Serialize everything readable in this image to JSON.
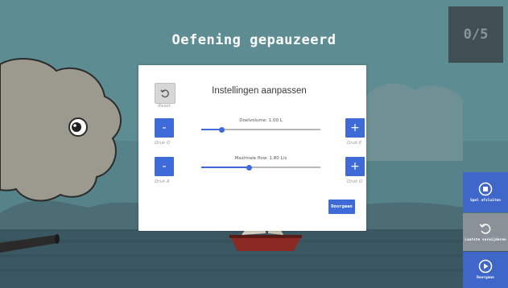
{
  "header": {
    "title": "Oefening gepauzeerd",
    "progress": "0/5"
  },
  "modal": {
    "title": "Instellingen aanpassen",
    "reset_label": "Reset",
    "sliders": [
      {
        "label": "Doelvolume: 1.00 L",
        "value_fraction": 0.17,
        "minus_label": "-",
        "plus_label": "+",
        "minus_hint": "Druk Q",
        "plus_hint": "Druk E"
      },
      {
        "label": "Maximale flow: 1.80 L/s",
        "value_fraction": 0.4,
        "minus_label": "-",
        "plus_label": "+",
        "minus_hint": "Druk A",
        "plus_hint": "Druk D"
      }
    ],
    "continue_label": "Doorgaan"
  },
  "sidebar": {
    "items": [
      {
        "label": "Spel afsluiten",
        "icon": "stop-circle-icon"
      },
      {
        "label": "Laatste verwijderen",
        "icon": "undo-icon"
      },
      {
        "label": "Doorgaan",
        "icon": "play-circle-icon"
      }
    ]
  },
  "colors": {
    "accent": "#3e6bd8",
    "sidebar_blue": "#3f66c9",
    "sidebar_gray": "#8a9197",
    "sky": "#5f8e94",
    "sea": "#3d5a66"
  }
}
